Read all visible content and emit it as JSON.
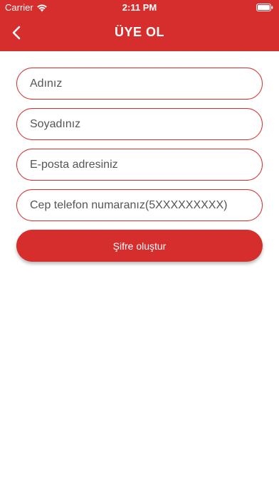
{
  "status_bar": {
    "carrier": "Carrier",
    "time": "2:11 PM",
    "wifi_icon": "wifi-icon",
    "battery_icon": "battery-icon"
  },
  "header": {
    "title": "ÜYE OL",
    "back_icon": "chevron-left-icon",
    "background_color": "#d62d2d"
  },
  "form": {
    "fields": [
      {
        "placeholder": "Adınız",
        "value": ""
      },
      {
        "placeholder": "Soyadınız",
        "value": ""
      },
      {
        "placeholder": "E-posta adresiniz",
        "value": ""
      },
      {
        "placeholder": "Cep telefon numaranız(5XXXXXXXXX)",
        "value": ""
      }
    ],
    "submit_label": "Şifre oluştur"
  },
  "colors": {
    "accent": "#d62d2d",
    "placeholder_text": "#555555",
    "background": "#ffffff"
  }
}
